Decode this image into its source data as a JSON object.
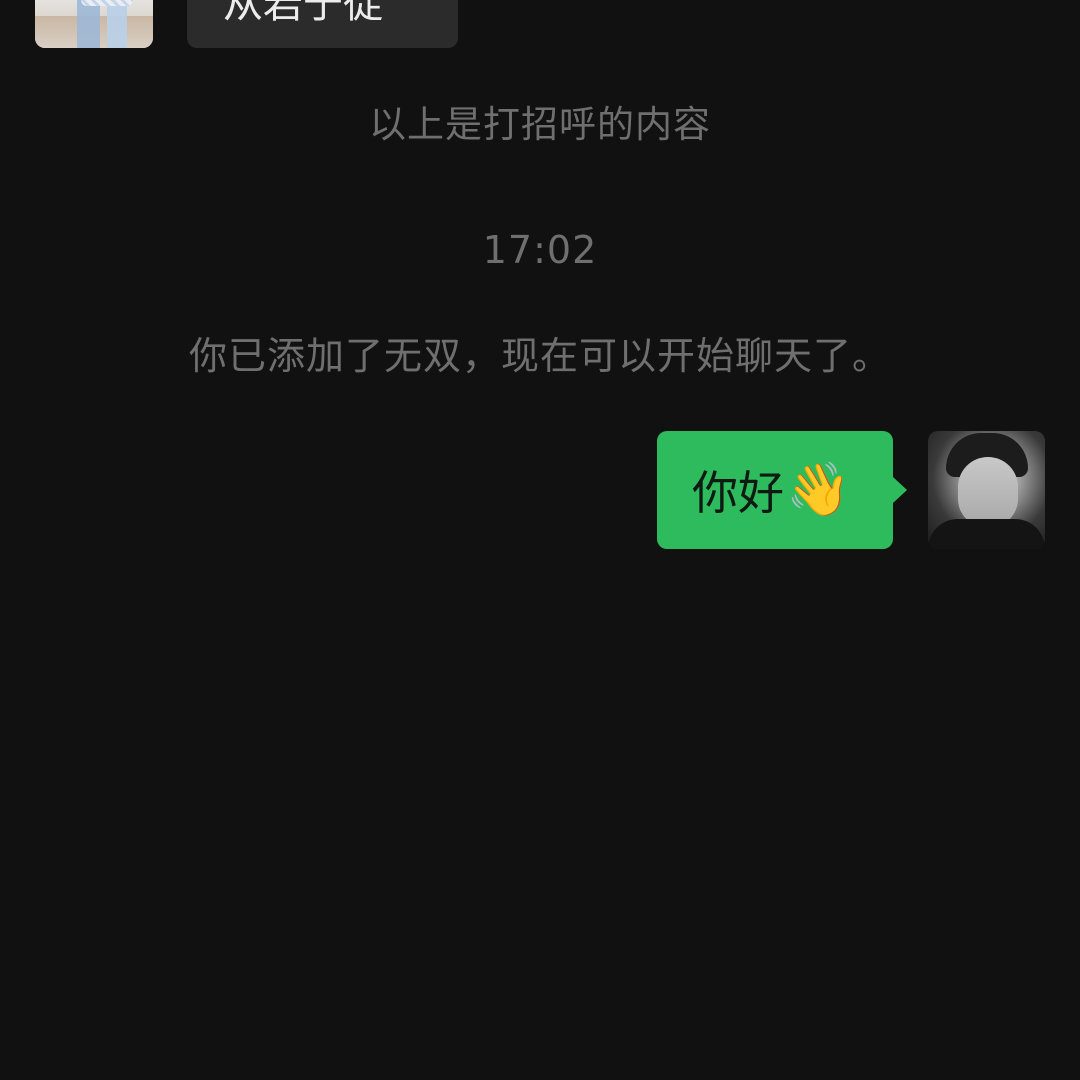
{
  "conversation": {
    "incoming_message": {
      "text": "从岩于徒"
    },
    "greeting_note": "以上是打招呼的内容",
    "timestamp": "17:02",
    "added_note": "你已添加了无双，现在可以开始聊天了。",
    "outgoing_message": {
      "text": "你好",
      "emoji": "👋"
    }
  },
  "colors": {
    "background": "#111111",
    "incoming_bubble": "#2b2b2b",
    "outgoing_bubble": "#2dbb5d",
    "system_text": "#6f6f6f"
  },
  "icons": {
    "wave": "waving-hand-icon"
  }
}
